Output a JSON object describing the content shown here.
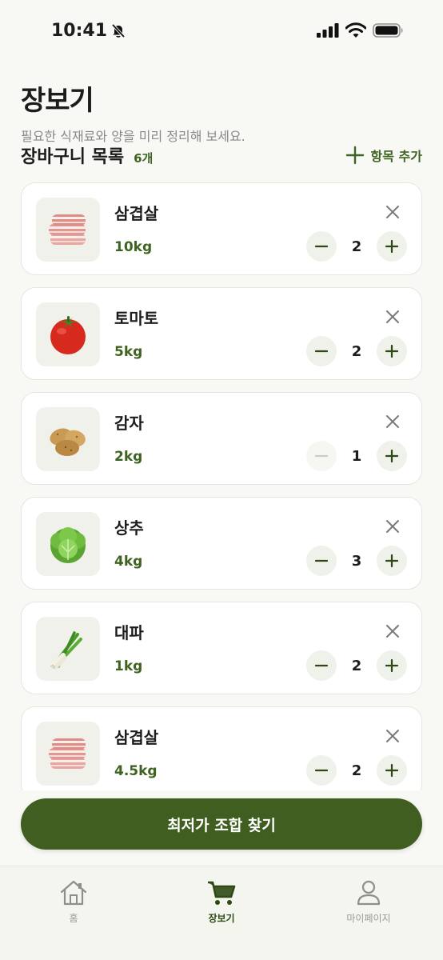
{
  "status_bar": {
    "time": "10:41"
  },
  "header": {
    "title": "장보기",
    "subtitle": "필요한 식재료와 양을 미리 정리해 보세요."
  },
  "list": {
    "title": "장바구니 목록",
    "count": "6개",
    "add_label": "항목 추가"
  },
  "items": [
    {
      "name": "삼겹살",
      "weight": "10kg",
      "quantity": "2",
      "image": "pork-belly-icon"
    },
    {
      "name": "토마토",
      "weight": "5kg",
      "quantity": "2",
      "image": "tomato-icon"
    },
    {
      "name": "감자",
      "weight": "2kg",
      "quantity": "1",
      "image": "potato-icon",
      "decrement_disabled": true
    },
    {
      "name": "상추",
      "weight": "4kg",
      "quantity": "3",
      "image": "lettuce-icon"
    },
    {
      "name": "대파",
      "weight": "1kg",
      "quantity": "2",
      "image": "green-onion-icon"
    },
    {
      "name": "삼겹살",
      "weight": "4.5kg",
      "quantity": "2",
      "image": "pork-belly-icon"
    }
  ],
  "cta": {
    "label": "최저가 조합 찾기"
  },
  "tabbar": {
    "tabs": [
      {
        "label": "홈",
        "icon": "home-icon"
      },
      {
        "label": "장보기",
        "icon": "cart-icon",
        "active": true
      },
      {
        "label": "마이페이지",
        "icon": "person-icon"
      }
    ]
  },
  "colors": {
    "accent": "#3f5e1f",
    "accent_text": "#3f6320",
    "background": "#f8f8f5",
    "card": "#ffffff"
  }
}
